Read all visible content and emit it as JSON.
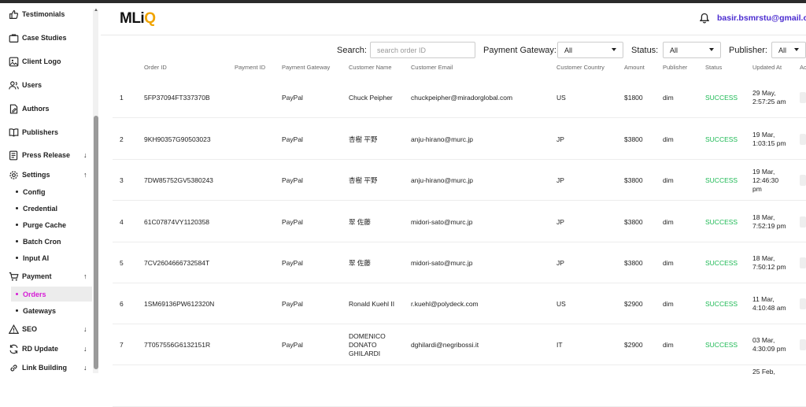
{
  "sidebar": {
    "items": [
      {
        "label": "Testimonials",
        "icon": "thumbs-up-icon"
      },
      {
        "label": "Case Studies",
        "icon": "briefcase-icon"
      },
      {
        "label": "Client Logo",
        "icon": "image-icon"
      },
      {
        "label": "Users",
        "icon": "users-icon"
      },
      {
        "label": "Authors",
        "icon": "pen-icon"
      },
      {
        "label": "Publishers",
        "icon": "book-icon"
      },
      {
        "label": "Press Release",
        "icon": "newspaper-icon",
        "arrow": "↓"
      },
      {
        "label": "Settings",
        "icon": "gear-icon",
        "arrow": "↑"
      },
      {
        "label": "Payment",
        "icon": "cart-icon",
        "arrow": "↑"
      },
      {
        "label": "SEO",
        "icon": "warning-icon",
        "arrow": "↓"
      },
      {
        "label": "RD Update",
        "icon": "refresh-icon",
        "arrow": "↓"
      },
      {
        "label": "Link Building",
        "icon": "link-icon",
        "arrow": "↓"
      }
    ],
    "settings_sub": [
      "Config",
      "Credential",
      "Purge Cache",
      "Batch Cron",
      "Input AI"
    ],
    "payment_sub": [
      "Orders",
      "Gateways"
    ]
  },
  "header": {
    "logo_main": "MLi",
    "logo_accent": "Q",
    "user_email": "basir.bsmrstu@gmail.co"
  },
  "filters": {
    "search_label": "Search:",
    "search_placeholder": "search order ID",
    "gateway_label": "Payment Gateway:",
    "gateway_value": "All",
    "status_label": "Status:",
    "status_value": "All",
    "publisher_label": "Publisher:",
    "publisher_value": "All"
  },
  "table": {
    "headers": [
      "Order ID",
      "Payment ID",
      "Payment Gateway",
      "Customer Name",
      "Customer Email",
      "Customer Country",
      "Amount",
      "Publisher",
      "Status",
      "Updated At",
      "Ac"
    ],
    "rows": [
      {
        "no": "1",
        "order_id": "5FP37094FT337370B",
        "gateway": "PayPal",
        "name": "Chuck Peipher",
        "email": "chuckpeipher@miradorglobal.com",
        "country": "US",
        "amount": "$1800",
        "publisher": "dim",
        "status": "SUCCESS",
        "updated": "29 May, 2:57:25 am"
      },
      {
        "no": "2",
        "order_id": "9KH90357G90503023",
        "gateway": "PayPal",
        "name": "杏樹 平野",
        "email": "anju-hirano@murc.jp",
        "country": "JP",
        "amount": "$3800",
        "publisher": "dim",
        "status": "SUCCESS",
        "updated": "19 Mar, 1:03:15 pm"
      },
      {
        "no": "3",
        "order_id": "7DW85752GV5380243",
        "gateway": "PayPal",
        "name": "杏樹 平野",
        "email": "anju-hirano@murc.jp",
        "country": "JP",
        "amount": "$3800",
        "publisher": "dim",
        "status": "SUCCESS",
        "updated": "19 Mar, 12:46:30 pm"
      },
      {
        "no": "4",
        "order_id": "61C07874VY1120358",
        "gateway": "PayPal",
        "name": "翠 佐藤",
        "email": "midori-sato@murc.jp",
        "country": "JP",
        "amount": "$3800",
        "publisher": "dim",
        "status": "SUCCESS",
        "updated": "18 Mar, 7:52:19 pm"
      },
      {
        "no": "5",
        "order_id": "7CV2604666732584T",
        "gateway": "PayPal",
        "name": "翠 佐藤",
        "email": "midori-sato@murc.jp",
        "country": "JP",
        "amount": "$3800",
        "publisher": "dim",
        "status": "SUCCESS",
        "updated": "18 Mar, 7:50:12 pm"
      },
      {
        "no": "6",
        "order_id": "1SM69136PW612320N",
        "gateway": "PayPal",
        "name": "Ronald Kuehl II",
        "email": "r.kuehl@polydeck.com",
        "country": "US",
        "amount": "$2900",
        "publisher": "dim",
        "status": "SUCCESS",
        "updated": "11 Mar, 4:10:48 am"
      },
      {
        "no": "7",
        "order_id": "7T057556G6132151R",
        "gateway": "PayPal",
        "name": "DOMENICO DONATO GHILARDI",
        "email": "dghilardi@negribossi.it",
        "country": "IT",
        "amount": "$2900",
        "publisher": "dim",
        "status": "SUCCESS",
        "updated": "03 Mar, 4:30:09 pm"
      },
      {
        "no": "",
        "order_id": "",
        "gateway": "",
        "name": "",
        "email": "",
        "country": "",
        "amount": "",
        "publisher": "",
        "status": "",
        "updated": "25 Feb,"
      }
    ]
  }
}
